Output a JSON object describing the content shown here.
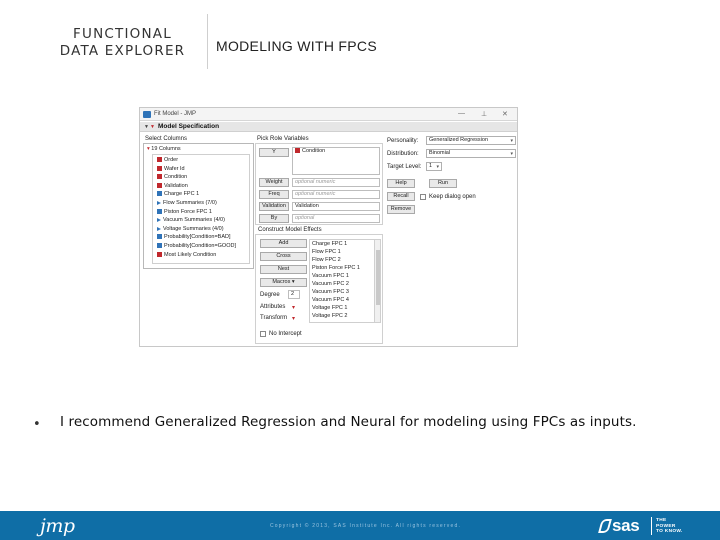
{
  "header": {
    "left_line1": "FUNCTIONAL",
    "left_line2": "DATA EXPLORER",
    "right_title": "MODELING WITH FPCS"
  },
  "window": {
    "title": "Fit Model - JMP",
    "controls": {
      "minimize": "—",
      "maximize": "⊥",
      "close": "✕"
    },
    "spec_title": "Model Specification",
    "select_columns": {
      "label": "Select Columns",
      "count": "19 Columns",
      "items": [
        {
          "label": "Order",
          "icon": "red"
        },
        {
          "label": "Wafer Id",
          "icon": "red"
        },
        {
          "label": "Condition",
          "icon": "red"
        },
        {
          "label": "Validation",
          "icon": "red"
        },
        {
          "label": "Charge FPC 1",
          "icon": "blue"
        },
        {
          "label": "Flow Summaries (7/0)",
          "icon": "tri"
        },
        {
          "label": "Piston Force FPC 1",
          "icon": "blue"
        },
        {
          "label": "Vacuum Summaries (4/0)",
          "icon": "tri"
        },
        {
          "label": "Voltage Summaries (4/0)",
          "icon": "tri"
        },
        {
          "label": "Probability[Condition=BAD]",
          "icon": "blue"
        },
        {
          "label": "Probability[Condition=GOOD]",
          "icon": "blue"
        },
        {
          "label": "Most Likely Condition",
          "icon": "red"
        }
      ]
    },
    "pick_role": {
      "label": "Pick Role Variables",
      "y_button": "Y",
      "y_value": "Condition",
      "weight_button": "Weight",
      "weight_placeholder": "optional numeric",
      "freq_button": "Freq",
      "freq_placeholder": "optional numeric",
      "validation_button": "Validation",
      "validation_value": "Validation",
      "by_button": "By",
      "by_placeholder": "optional"
    },
    "personality": {
      "personality_label": "Personality:",
      "personality_value": "Generalized Regression",
      "distribution_label": "Distribution:",
      "distribution_value": "Binomial",
      "target_label": "Target Level:",
      "target_value": "1",
      "help_button": "Help",
      "run_button": "Run",
      "recall_button": "Recall",
      "keep_dialog": "Keep dialog open",
      "remove_button": "Remove"
    },
    "effects": {
      "label": "Construct Model Effects",
      "add_button": "Add",
      "cross_button": "Cross",
      "nest_button": "Nest",
      "macros_button": "Macros",
      "degree_label": "Degree",
      "degree_value": "2",
      "attributes_label": "Attributes",
      "transform_label": "Transform",
      "no_intercept": "No Intercept",
      "items": [
        "Charge FPC 1",
        "Flow FPC 1",
        "Flow FPC 2",
        "Piston Force FPC 1",
        "Vacuum FPC 1",
        "Vacuum FPC 2",
        "Vacuum FPC 3",
        "Vacuum FPC 4",
        "Voltage FPC 1",
        "Voltage FPC 2"
      ]
    }
  },
  "bullet": {
    "marker": "•",
    "text": "I recommend Generalized Regression and Neural for modeling using FPCs as inputs."
  },
  "footer": {
    "jmp_logo": "jmp",
    "copyright": "Copyright © 2013, SAS Institute Inc. All rights reserved.",
    "sas_logo": "sas",
    "tagline1": "THE",
    "tagline2": "POWER",
    "tagline3": "TO KNOW."
  },
  "colors": {
    "footer_bg": "#0f6ea6",
    "accent_red": "#c0282d",
    "accent_blue": "#2f73b8"
  }
}
